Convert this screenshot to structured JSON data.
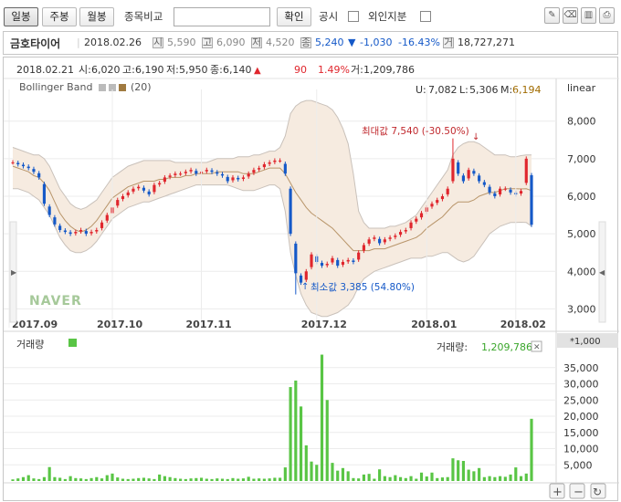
{
  "toolbar": {
    "period_buttons": [
      {
        "label": "일봉",
        "active": true
      },
      {
        "label": "주봉",
        "active": false
      },
      {
        "label": "월봉",
        "active": false
      }
    ],
    "compare_label": "종목비교",
    "compare_input_value": "",
    "confirm_label": "확인",
    "notice_label": "공시",
    "foreign_label": "외인지분",
    "icons": [
      "pen-icon",
      "eraser-icon",
      "chart-icon",
      "print-icon"
    ]
  },
  "quote": {
    "name": "금호타이어",
    "date": "2018.02.26",
    "open_icon": "시",
    "open": "5,590",
    "high_icon": "고",
    "high": "6,090",
    "low_icon": "저",
    "low": "4,520",
    "close_icon": "종",
    "close": "5,240",
    "change_arrow": "▼",
    "change": "-1,030",
    "change_pct": "-16.43%",
    "volume_icon": "거",
    "volume": "18,727,271"
  },
  "hover": {
    "date": "2018.02.21",
    "open_label": "시:",
    "open": "6,020",
    "high_label": "고:",
    "high": "6,190",
    "low_label": "저:",
    "low": "5,950",
    "close_label": "종:",
    "close": "6,140",
    "arrow": "▲",
    "change": "90",
    "change_pct": "1.49%",
    "volume_label": "거:",
    "volume": "1,209,786"
  },
  "indicator": {
    "name": "Bollinger Band",
    "period": "(20)",
    "u_label": "U:",
    "u": "7,082",
    "l_label": "L:",
    "l": "5,306",
    "m_label": "M:",
    "m": "6,194"
  },
  "scale_label": "linear",
  "annotations": {
    "max_label": "최대값 7,540 (-30.50%)",
    "min_label": "최소값 3,385 (54.80%)"
  },
  "watermark": "NAVER",
  "volume_panel": {
    "title": "거래량",
    "legend_label": "거래량:",
    "legend_value": "1,209,786",
    "unit": "*1,000"
  },
  "colors": {
    "up": "#e0262d",
    "down": "#1559c8",
    "volume": "#59c545",
    "band_fill": "#f6ebe0",
    "mid_line": "#b8956a"
  },
  "chart_data": [
    {
      "type": "candlestick",
      "title": "",
      "x_ticks": [
        "2017.09",
        "2017.10",
        "2017.11",
        "2017.12",
        "2018.01",
        "2018.02"
      ],
      "y_ticks": [
        3000,
        4000,
        5000,
        6000,
        7000,
        8000
      ],
      "ylim": [
        2500,
        8600
      ],
      "closes": [
        6900,
        6850,
        6800,
        6750,
        6650,
        6500,
        5800,
        5500,
        5250,
        5100,
        5050,
        5000,
        5050,
        5100,
        5000,
        5050,
        5100,
        5300,
        5500,
        5700,
        5900,
        6000,
        6100,
        6200,
        6250,
        6150,
        6050,
        6300,
        6350,
        6500,
        6550,
        6600,
        6600,
        6650,
        6700,
        6600,
        6650,
        6700,
        6650,
        6600,
        6550,
        6400,
        6500,
        6450,
        6500,
        6600,
        6700,
        6750,
        6850,
        6900,
        6950,
        6950,
        6600,
        5000,
        3950,
        3700,
        4000,
        4450,
        4250,
        4150,
        4200,
        4350,
        4150,
        4250,
        4300,
        4250,
        4500,
        4700,
        4850,
        4900,
        4750,
        4850,
        4900,
        4950,
        5050,
        5100,
        5300,
        5400,
        5550,
        5700,
        5800,
        5900,
        6000,
        6200,
        7000,
        6600,
        6400,
        6700,
        6600,
        6400,
        6300,
        6100,
        6000,
        6200,
        6200,
        6100,
        6050,
        6140,
        7000,
        5240
      ],
      "band_upper": [
        7300,
        7250,
        7200,
        7150,
        7100,
        7100,
        7000,
        6800,
        6500,
        6200,
        6000,
        5800,
        5700,
        5650,
        5700,
        5800,
        5900,
        6100,
        6300,
        6500,
        6600,
        6700,
        6800,
        6850,
        6900,
        6950,
        6950,
        6950,
        6950,
        6950,
        6950,
        6900,
        6900,
        6900,
        6900,
        6900,
        6900,
        6900,
        6950,
        7000,
        7000,
        7000,
        7000,
        7050,
        7050,
        7050,
        7100,
        7100,
        7150,
        7200,
        7200,
        7300,
        7600,
        8200,
        8400,
        8500,
        8550,
        8550,
        8500,
        8450,
        8400,
        8300,
        8100,
        7800,
        7400,
        6600,
        5600,
        5300,
        5150,
        5150,
        5150,
        5150,
        5200,
        5200,
        5250,
        5300,
        5400,
        5500,
        5700,
        5900,
        6100,
        6300,
        6500,
        6700,
        7100,
        7300,
        7400,
        7450,
        7450,
        7400,
        7300,
        7200,
        7100,
        7100,
        7100,
        7050,
        7050,
        7082,
        7100,
        7100
      ],
      "band_lower": [
        6200,
        6200,
        6150,
        6100,
        6000,
        5900,
        5700,
        5500,
        5200,
        4900,
        4700,
        4550,
        4500,
        4500,
        4550,
        4650,
        4800,
        5000,
        5200,
        5400,
        5500,
        5600,
        5700,
        5750,
        5800,
        5850,
        5850,
        5900,
        5950,
        6000,
        6050,
        6100,
        6150,
        6200,
        6250,
        6300,
        6300,
        6300,
        6300,
        6300,
        6300,
        6300,
        6250,
        6200,
        6150,
        6150,
        6150,
        6200,
        6250,
        6300,
        6300,
        6200,
        5600,
        4500,
        3900,
        3400,
        3100,
        2900,
        2850,
        2800,
        2800,
        2850,
        2900,
        3000,
        3100,
        3300,
        3600,
        3800,
        3900,
        4000,
        4050,
        4100,
        4150,
        4200,
        4250,
        4300,
        4350,
        4350,
        4350,
        4400,
        4400,
        4450,
        4500,
        4500,
        4400,
        4300,
        4250,
        4300,
        4400,
        4600,
        4800,
        5000,
        5100,
        5200,
        5250,
        5300,
        5300,
        5306,
        5300,
        5200
      ],
      "band_mid": [
        6800,
        6750,
        6700,
        6650,
        6550,
        6500,
        6350,
        6150,
        5850,
        5550,
        5350,
        5200,
        5100,
        5050,
        5100,
        5200,
        5350,
        5550,
        5750,
        5950,
        6050,
        6150,
        6250,
        6300,
        6350,
        6400,
        6400,
        6400,
        6450,
        6450,
        6500,
        6500,
        6500,
        6550,
        6550,
        6600,
        6600,
        6600,
        6600,
        6650,
        6650,
        6650,
        6650,
        6650,
        6600,
        6600,
        6600,
        6650,
        6700,
        6750,
        6750,
        6750,
        6600,
        6350,
        6100,
        5900,
        5700,
        5550,
        5450,
        5350,
        5250,
        5150,
        5000,
        4850,
        4700,
        4550,
        4550,
        4550,
        4550,
        4600,
        4600,
        4600,
        4650,
        4700,
        4750,
        4800,
        4850,
        4900,
        5000,
        5150,
        5250,
        5350,
        5450,
        5600,
        5750,
        5850,
        5850,
        5850,
        5900,
        6000,
        6050,
        6100,
        6100,
        6150,
        6200,
        6200,
        6200,
        6194,
        6200,
        6150
      ],
      "max_point": {
        "index": 84,
        "value": 7540
      },
      "min_point": {
        "index": 54,
        "value": 3385
      }
    },
    {
      "type": "bar",
      "title": "",
      "y_ticks": [
        5000,
        10000,
        15000,
        20000,
        25000,
        30000,
        35000
      ],
      "ylim": [
        0,
        40000
      ],
      "values": [
        500,
        800,
        1200,
        1800,
        800,
        600,
        1200,
        4300,
        1200,
        1000,
        600,
        1500,
        900,
        800,
        600,
        900,
        1200,
        800,
        1800,
        2300,
        1100,
        700,
        600,
        700,
        900,
        1000,
        800,
        600,
        2000,
        1500,
        1200,
        900,
        700,
        600,
        800,
        900,
        1000,
        700,
        600,
        800,
        700,
        600,
        900,
        700,
        800,
        1300,
        700,
        800,
        700,
        800,
        1000,
        1000,
        4200,
        29000,
        31000,
        23000,
        11000,
        6000,
        5000,
        39000,
        25000,
        5600,
        3200,
        4000,
        3000,
        900,
        800,
        2000,
        2200,
        700,
        3600,
        1500,
        1200,
        1800,
        1200,
        900,
        1500,
        700,
        2600,
        1400,
        2600,
        900,
        1100,
        1200,
        7000,
        6400,
        6200,
        3500,
        3000,
        4000,
        1200,
        1500,
        1200,
        1500,
        1300,
        2000,
        4200,
        1500,
        2300,
        19200
      ]
    }
  ]
}
